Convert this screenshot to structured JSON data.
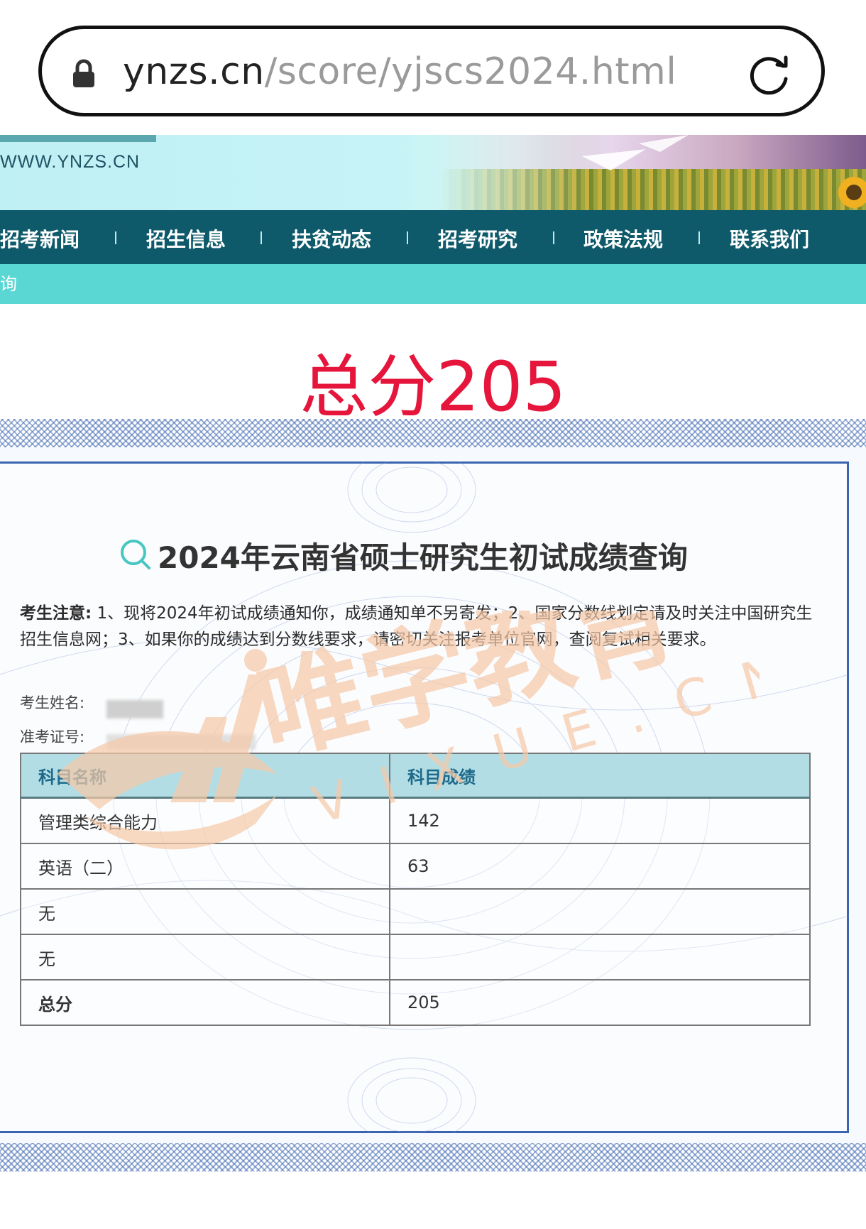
{
  "browser": {
    "url_domain": "ynzs.cn",
    "url_path": "/score/yjscs2024.html"
  },
  "site": {
    "url_text": "WWW.YNZS.CN",
    "nav": [
      "招考新闻",
      "招生信息",
      "扶贫动态",
      "招考研究",
      "政策法规",
      "联系我们"
    ],
    "subbar_text": "询"
  },
  "overlay": {
    "total_heading": "总分205",
    "watermark_text": "唯学教育",
    "watermark_sub": "VIXUE.CN"
  },
  "results": {
    "title": "2024年云南省硕士研究生初试成绩查询",
    "notice_label": "考生注意:",
    "notice_text": " 1、现将2024年初试成绩通知你，成绩通知单不另寄发；2、国家分数线划定请及时关注中国研究生招生信息网；3、如果你的成绩达到分数线要求，请密切关注报考单位官网，查阅复试相关要求。",
    "name_label": "考生姓名:",
    "id_label": "准考证号:",
    "table": {
      "headers": [
        "科目名称",
        "科目成绩"
      ],
      "rows": [
        {
          "subject": "管理类综合能力",
          "score": "142"
        },
        {
          "subject": "英语（二）",
          "score": "63"
        },
        {
          "subject": "无",
          "score": ""
        },
        {
          "subject": "无",
          "score": ""
        },
        {
          "subject": "总分",
          "score": "205"
        }
      ]
    }
  },
  "colors": {
    "nav_bg": "#0e5a6a",
    "subbar_bg": "#5ad6d3",
    "heading_red": "#e5153c",
    "frame_blue": "#3b64b0",
    "table_header_bg": "#b3dde4",
    "watermark": "#f6c9a8"
  }
}
